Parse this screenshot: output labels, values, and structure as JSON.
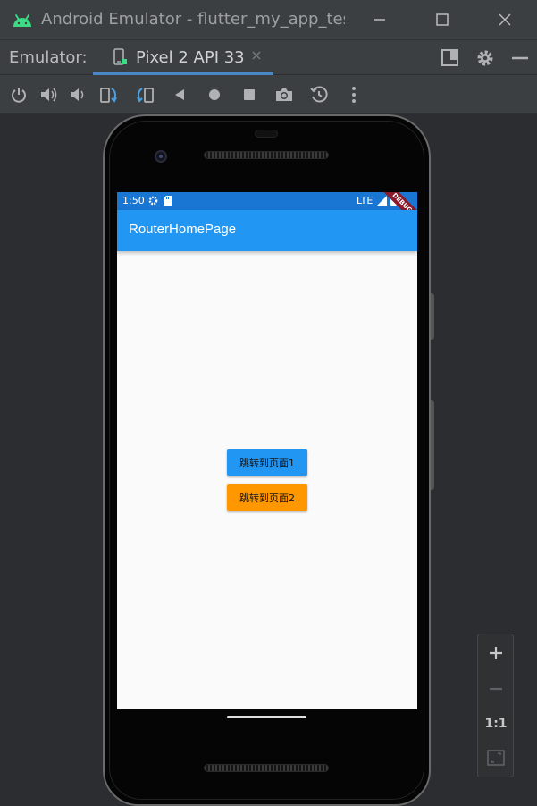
{
  "window": {
    "title": "Android Emulator - flutter_my_app_test",
    "controls": [
      "minimize-icon",
      "maximize-icon",
      "close-icon"
    ]
  },
  "tabbar": {
    "label": "Emulator:",
    "tab_label": "Pixel 2 API 33",
    "right_icons": [
      "layout-icon",
      "gear-icon",
      "minimize-panel-icon"
    ]
  },
  "toolbar": {
    "icons": [
      "power-icon",
      "volume-up-icon",
      "volume-down-icon",
      "rotate-left-icon",
      "rotate-right-icon",
      "back-icon",
      "home-icon",
      "overview-icon",
      "camera-icon",
      "snapshot-icon",
      "more-icon"
    ]
  },
  "phone": {
    "status_time": "1:50",
    "status_network": "LTE",
    "app_title": "RouterHomePage",
    "debug_banner": "DEBUG",
    "button1_label": "跳转到页面1",
    "button2_label": "跳转到页面2"
  },
  "zoom": {
    "zoom_in": "+",
    "zoom_out": "−",
    "one_to_one": "1:1"
  },
  "colors": {
    "appbar": "#2196f3",
    "statusbar": "#1976d2",
    "button1": "#2196f3",
    "button2": "#ff9800",
    "ide_background": "#2b2d30",
    "tab_accent": "#4a88c7"
  }
}
